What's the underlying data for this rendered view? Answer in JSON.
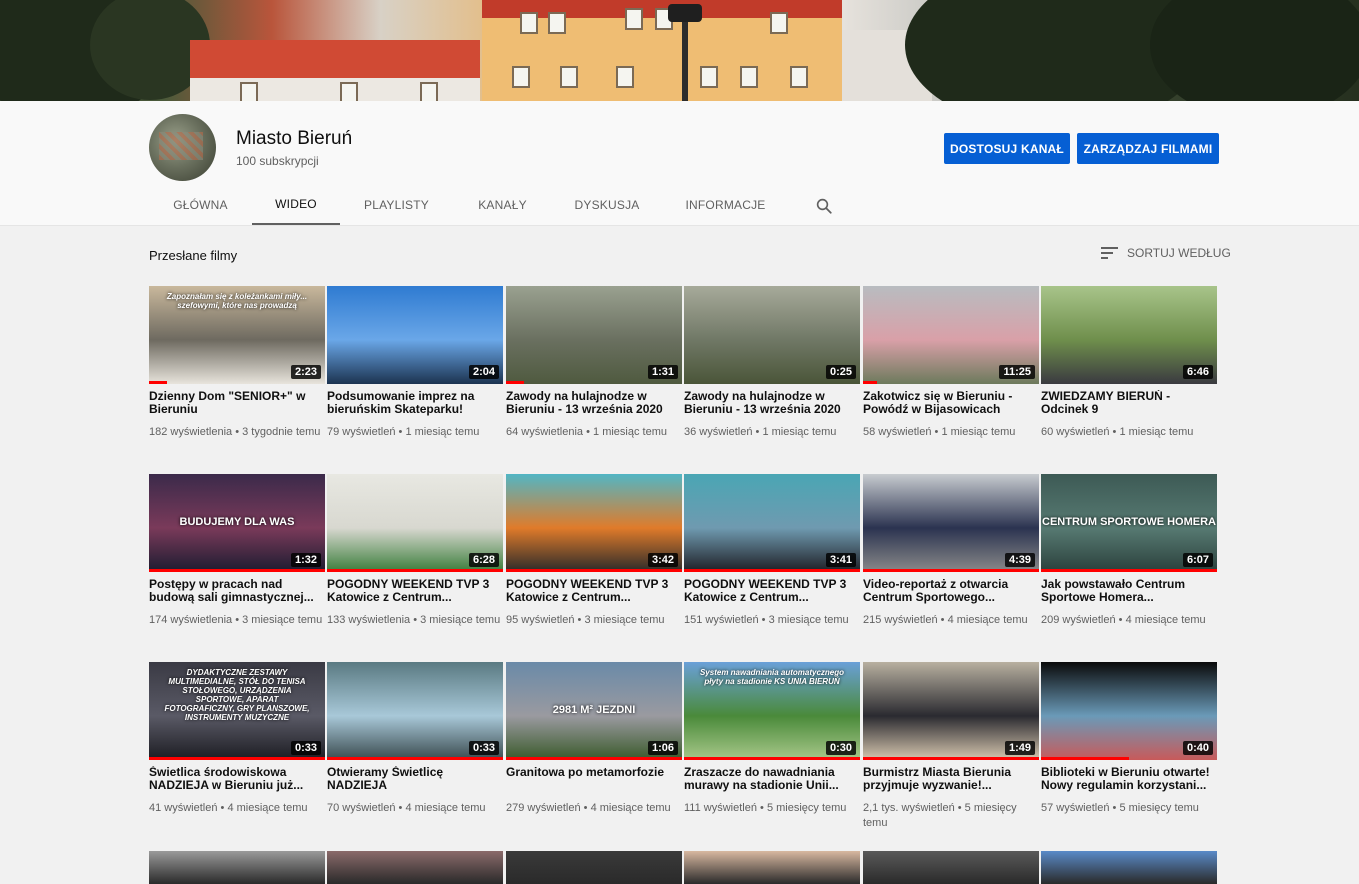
{
  "channel": {
    "name": "Miasto Bieruń",
    "subscribers": "100 subskrypcji",
    "customize_button": "DOSTOSUJ KANAŁ",
    "manage_button": "ZARZĄDZAJ FILMAMI"
  },
  "tabs": [
    "GŁÓWNA",
    "WIDEO",
    "PLAYLISTY",
    "KANAŁY",
    "DYSKUSJA",
    "INFORMACJE"
  ],
  "active_tab": "WIDEO",
  "section": {
    "title": "Przesłane filmy",
    "sort_label": "SORTUJ WEDŁUG"
  },
  "colors": {
    "accent": "#065fd4",
    "progress": "#ff0000"
  },
  "videos": [
    {
      "title": "Dzienny Dom \"SENIOR+\" w Bieruniu",
      "views": "182 wyświetlenia",
      "age": "3 tygodnie temu",
      "duration": "2:23",
      "overlay": "Zapoznałam się z koleżankami miły... szefowymi, które nas prowadzą",
      "progress": 0.1,
      "palette": [
        "#c9b89c",
        "#6e6a60",
        "#e8e4dc"
      ]
    },
    {
      "title": "Podsumowanie imprez na bieruńskim Skateparku!",
      "views": "79 wyświetleń",
      "age": "1 miesiąc temu",
      "duration": "2:04",
      "overlay": "",
      "progress": 0,
      "palette": [
        "#2f7bd1",
        "#6aa7e8",
        "#1c3350"
      ]
    },
    {
      "title": "Zawody na hulajnodze w Bieruniu - 13 września 2020",
      "views": "64 wyświetlenia",
      "age": "1 miesiąc temu",
      "duration": "1:31",
      "overlay": "",
      "progress": 0.1,
      "palette": [
        "#9aa190",
        "#6a7060",
        "#4f5a3f"
      ]
    },
    {
      "title": "Zawody na hulajnodze w Bieruniu - 13 września 2020",
      "views": "36 wyświetleń",
      "age": "1 miesiąc temu",
      "duration": "0:25",
      "overlay": "",
      "progress": 0,
      "palette": [
        "#a7aa9a",
        "#707866",
        "#4a5538"
      ]
    },
    {
      "title": "Zakotwicz się w Bieruniu - Powódź w Bijasowicach",
      "views": "58 wyświetleń",
      "age": "1 miesiąc temu",
      "duration": "11:25",
      "overlay": "",
      "progress": 0.08,
      "palette": [
        "#b8bcc0",
        "#d9a0a8",
        "#6c7a5c"
      ]
    },
    {
      "title": "ZWIEDZAMY BIERUŃ - Odcinek 9",
      "views": "60 wyświetleń",
      "age": "1 miesiąc temu",
      "duration": "6:46",
      "overlay": "",
      "progress": 0,
      "palette": [
        "#a8c48a",
        "#6f8f4c",
        "#3a3a40"
      ]
    },
    {
      "title": "Postępy w pracach nad budową sali gimnastycznej...",
      "views": "174 wyświetlenia",
      "age": "3 miesiące temu",
      "duration": "1:32",
      "overlay": "BUDUJEMY DLA WAS",
      "progress": 1,
      "palette": [
        "#3b2a4a",
        "#7a3a5a",
        "#1c1c30"
      ]
    },
    {
      "title": "POGODNY WEEKEND TVP 3 Katowice z Centrum...",
      "views": "133 wyświetlenia",
      "age": "3 miesiące temu",
      "duration": "6:28",
      "overlay": "",
      "progress": 1,
      "palette": [
        "#e8e8e2",
        "#d8d8d0",
        "#3a7d3a"
      ]
    },
    {
      "title": "POGODNY WEEKEND TVP 3 Katowice z Centrum...",
      "views": "95 wyświetleń",
      "age": "3 miesiące temu",
      "duration": "3:42",
      "overlay": "",
      "progress": 1,
      "palette": [
        "#52b6c4",
        "#e07b2a",
        "#2a2a2a"
      ]
    },
    {
      "title": "POGODNY WEEKEND TVP 3 Katowice z Centrum...",
      "views": "151 wyświetleń",
      "age": "3 miesiące temu",
      "duration": "3:41",
      "overlay": "",
      "progress": 1,
      "palette": [
        "#4aa6b4",
        "#6f9ab0",
        "#1e1e24"
      ]
    },
    {
      "title": "Video-reportaż z otwarcia Centrum Sportowego...",
      "views": "215 wyświetleń",
      "age": "4 miesiące temu",
      "duration": "4:39",
      "overlay": "",
      "progress": 1,
      "palette": [
        "#c8ccd0",
        "#2b3350",
        "#8a8a8a"
      ]
    },
    {
      "title": "Jak powstawało Centrum Sportowe Homera...",
      "views": "209 wyświetleń",
      "age": "4 miesiące temu",
      "duration": "6:07",
      "overlay": "CENTRUM SPORTOWE HOMERA",
      "progress": 1,
      "palette": [
        "#3d5a55",
        "#577a72",
        "#2a403c"
      ]
    },
    {
      "title": "Świetlica środowiskowa NADZIEJA w Bieruniu już...",
      "views": "41 wyświetleń",
      "age": "4 miesiące temu",
      "duration": "0:33",
      "overlay": "DYDAKTYCZNE ZESTAWY MULTIMEDIALNE, STÓŁ DO TENISA STOŁOWEGO, URZĄDZENIA SPORTOWE, APARAT FOTOGRAFICZNY, GRY PLANSZOWE, INSTRUMENTY MUZYCZNE",
      "progress": 1,
      "palette": [
        "#3a3a44",
        "#5a5a66",
        "#1c1c22"
      ]
    },
    {
      "title": "Otwieramy Świetlicę NADZIEJA",
      "views": "70 wyświetleń",
      "age": "4 miesiące temu",
      "duration": "0:33",
      "overlay": "",
      "progress": 1,
      "palette": [
        "#5a7a82",
        "#a8c8d8",
        "#3a4a4e"
      ]
    },
    {
      "title": "Granitowa po metamorfozie",
      "views": "279 wyświetleń",
      "age": "4 miesiące temu",
      "duration": "1:06",
      "overlay": "2981 M² JEZDNI",
      "progress": 1,
      "palette": [
        "#6a8aa8",
        "#9a9aa0",
        "#3a5a2a"
      ]
    },
    {
      "title": "Zraszacze do nawadniania murawy na stadionie Unii...",
      "views": "111 wyświetleń",
      "age": "5 miesięcy temu",
      "duration": "0:30",
      "overlay": "System nawadniania automatycznego płyty na stadionie KS UNIA BIERUŃ",
      "progress": 1,
      "palette": [
        "#6aa0d8",
        "#4a8a3a",
        "#a8c88a"
      ]
    },
    {
      "title": "Burmistrz Miasta Bierunia przyjmuje wyzwanie!...",
      "views": "2,1 tys. wyświetleń",
      "age": "5 miesięcy temu",
      "duration": "1:49",
      "overlay": "",
      "progress": 1,
      "palette": [
        "#b8b0a0",
        "#2a2a30",
        "#d8c8b0"
      ]
    },
    {
      "title": "Biblioteki w Bieruniu otwarte! Nowy regulamin korzystani...",
      "views": "57 wyświetleń",
      "age": "5 miesięcy temu",
      "duration": "0:40",
      "overlay": "",
      "progress": 0.5,
      "palette": [
        "#0a0a0a",
        "#6a9ab8",
        "#c85a5a"
      ]
    }
  ]
}
